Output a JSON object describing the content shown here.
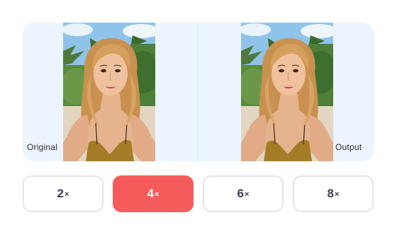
{
  "comparison": {
    "original_label": "Original",
    "output_label": "Output"
  },
  "scale_options": [
    {
      "number": "2",
      "suffix": "×",
      "selected": false
    },
    {
      "number": "4",
      "suffix": "×",
      "selected": true
    },
    {
      "number": "6",
      "suffix": "×",
      "selected": false
    },
    {
      "number": "8",
      "suffix": "×",
      "selected": false
    }
  ],
  "colors": {
    "panel_background": "#ecf5fe",
    "selected_accent": "#f65b5b",
    "button_text": "#3a3d4f",
    "button_border": "#e4e4e7"
  }
}
